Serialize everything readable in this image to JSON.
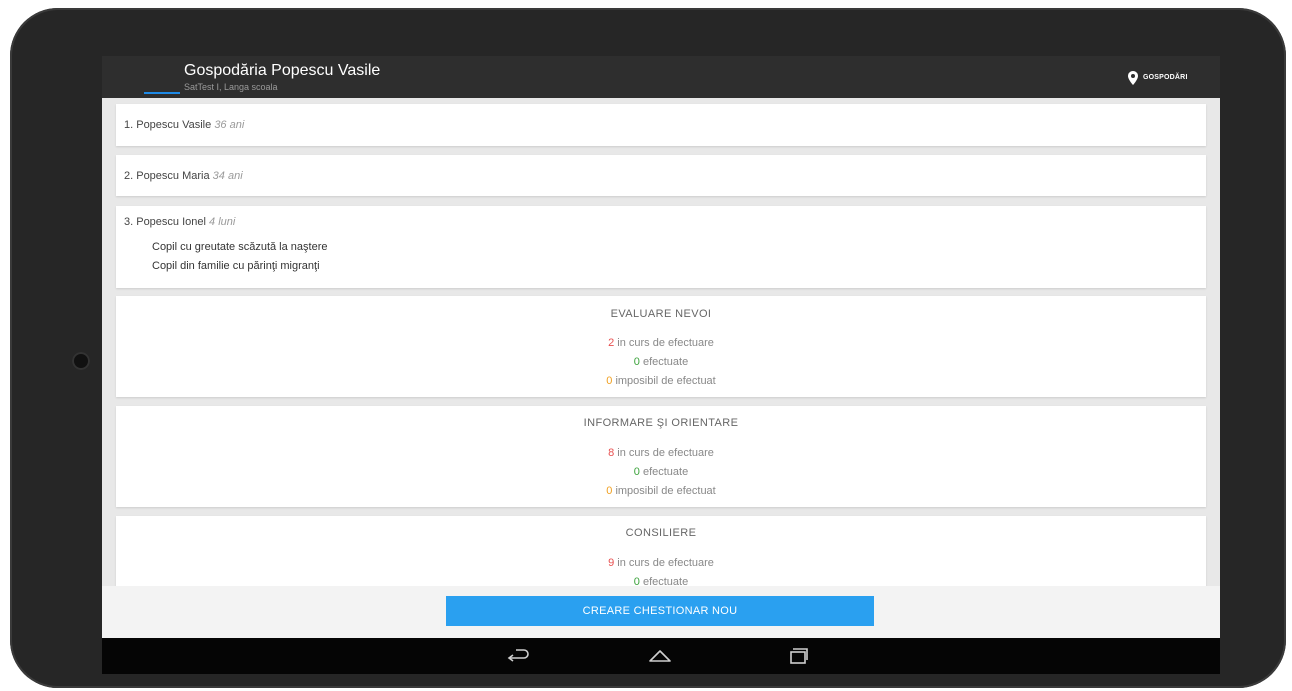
{
  "header": {
    "title": "Gospodăria Popescu Vasile",
    "subtitle": "SatTest I, Langa scoala",
    "action_label": "GOSPODĂRI",
    "action_icon": "map-pin-icon"
  },
  "members": [
    {
      "label": "1. Popescu Vasile",
      "age": "36 ani",
      "notes": []
    },
    {
      "label": "2. Popescu Maria",
      "age": "34 ani",
      "notes": []
    },
    {
      "label": "3. Popescu Ionel",
      "age": "4 luni",
      "notes": [
        "Copil cu greutate scăzută la naştere",
        "Copil din familie cu părinţi migranţi"
      ]
    }
  ],
  "sections": [
    {
      "title": "EVALUARE NEVOI",
      "in_progress": {
        "count": "2",
        "label": "in curs de efectuare"
      },
      "done": {
        "count": "0",
        "label": "efectuate"
      },
      "impossible": {
        "count": "0",
        "label": "imposibil de efectuat"
      }
    },
    {
      "title": "INFORMARE ŞI ORIENTARE",
      "in_progress": {
        "count": "8",
        "label": "in curs de efectuare"
      },
      "done": {
        "count": "0",
        "label": "efectuate"
      },
      "impossible": {
        "count": "0",
        "label": "imposibil de efectuat"
      }
    },
    {
      "title": "CONSILIERE",
      "in_progress": {
        "count": "9",
        "label": "in curs de efectuare"
      },
      "done": {
        "count": "0",
        "label": "efectuate"
      }
    }
  ],
  "footer": {
    "create_button": "CREARE CHESTIONAR NOU"
  },
  "navbar": {
    "back_icon": "back-icon",
    "home_icon": "home-icon",
    "recents_icon": "recents-icon"
  },
  "colors": {
    "accent": "#2aa0f0",
    "in_progress": "#e85050",
    "done": "#3da33d",
    "impossible": "#f0a020"
  }
}
